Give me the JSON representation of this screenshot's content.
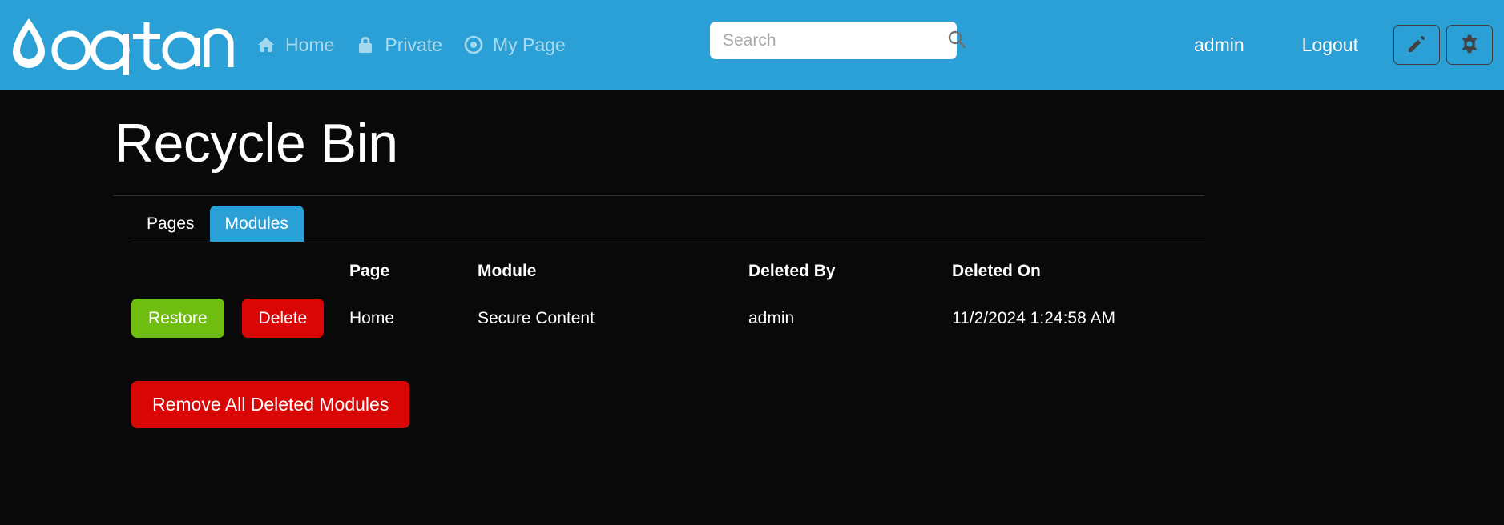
{
  "header": {
    "logo_text": "oqtane",
    "nav": [
      {
        "label": "Home",
        "icon": "home-icon"
      },
      {
        "label": "Private",
        "icon": "lock-icon"
      },
      {
        "label": "My Page",
        "icon": "bullseye-icon"
      }
    ],
    "search": {
      "placeholder": "Search",
      "value": "",
      "icon": "search-icon"
    },
    "user": "admin",
    "logout": "Logout",
    "edit_icon": "pencil-icon",
    "settings_icon": "gear-icon",
    "background_color": "#2BA0D6"
  },
  "page": {
    "title": "Recycle Bin"
  },
  "tabs": [
    {
      "label": "Pages",
      "active": false
    },
    {
      "label": "Modules",
      "active": true
    }
  ],
  "table": {
    "headers": {
      "actions": "",
      "page": "Page",
      "module": "Module",
      "deleted_by": "Deleted By",
      "deleted_on": "Deleted On"
    },
    "rows": [
      {
        "restore_label": "Restore",
        "delete_label": "Delete",
        "page": "Home",
        "module": "Secure Content",
        "deleted_by": "admin",
        "deleted_on": "11/2/2024 1:24:58 AM"
      }
    ]
  },
  "actions": {
    "remove_all_label": "Remove All Deleted Modules"
  },
  "colors": {
    "accent": "#2BA0D6",
    "restore_green": "#70BD12",
    "delete_red": "#D90606",
    "background": "#090909"
  }
}
